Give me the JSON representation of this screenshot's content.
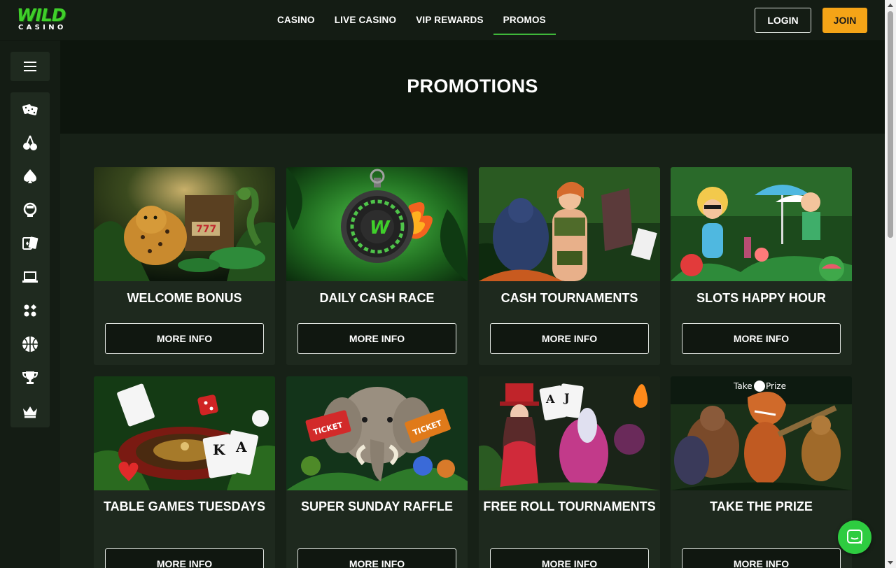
{
  "logo": {
    "top": "WILD",
    "bottom": "CASINO"
  },
  "nav": {
    "items": [
      {
        "label": "CASINO",
        "active": false
      },
      {
        "label": "LIVE CASINO",
        "active": false
      },
      {
        "label": "VIP REWARDS",
        "active": false
      },
      {
        "label": "PROMOS",
        "active": true
      }
    ]
  },
  "header": {
    "login_label": "LOGIN",
    "join_label": "JOIN"
  },
  "sidebar": {
    "icons": [
      "dice-icon",
      "cherry-icon",
      "spade-icon",
      "dealer-icon",
      "cards-icon",
      "laptop-icon",
      "four-dots-icon",
      "basketball-icon",
      "trophy-icon",
      "crown-icon"
    ]
  },
  "page": {
    "title": "PROMOTIONS"
  },
  "promos": [
    {
      "title": "WELCOME BONUS",
      "button": "MORE INFO"
    },
    {
      "title": "DAILY CASH RACE",
      "button": "MORE INFO"
    },
    {
      "title": "CASH TOURNAMENTS",
      "button": "MORE INFO"
    },
    {
      "title": "SLOTS HAPPY HOUR",
      "button": "MORE INFO"
    },
    {
      "title": "TABLE GAMES TUESDAYS",
      "button": "MORE INFO"
    },
    {
      "title": "SUPER SUNDAY RAFFLE",
      "button": "MORE INFO"
    },
    {
      "title": "FREE ROLL TOURNAMENTS",
      "button": "MORE INFO"
    },
    {
      "title": "TAKE THE PRIZE",
      "button": "MORE INFO"
    }
  ],
  "badges": {
    "take_prize": "Take",
    "take_prize_2": "Prize",
    "ticket": "TICKET"
  },
  "colors": {
    "accent_green": "#3fcf2a",
    "join_orange": "#f5a417",
    "chat_green": "#2ecc40"
  }
}
